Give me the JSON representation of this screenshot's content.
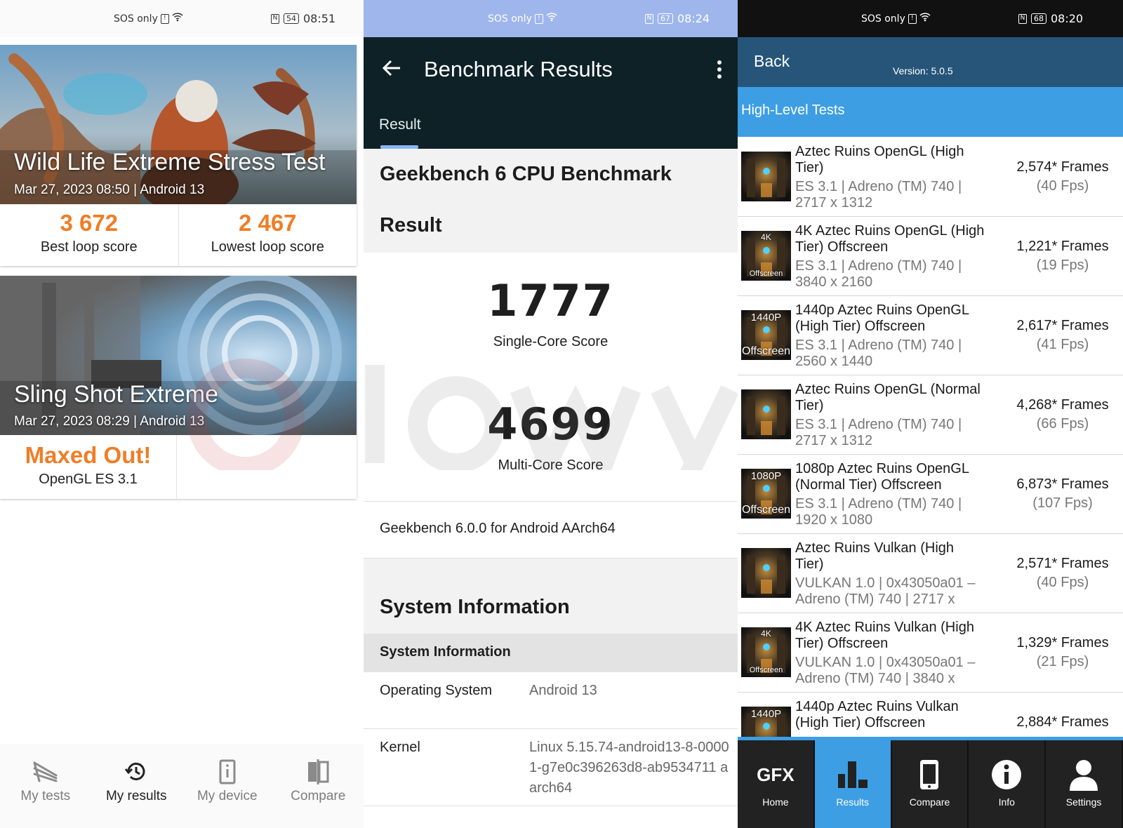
{
  "panel1": {
    "status": {
      "left": "SOS only",
      "battery": "54",
      "time": "08:51"
    },
    "cards": [
      {
        "title": "Wild Life Extreme Stress Test",
        "subtitle": "Mar 27, 2023 08:50 | Android 13",
        "score1_value": "3 672",
        "score1_label": "Best loop score",
        "score2_value": "2 467",
        "score2_label": "Lowest loop score"
      },
      {
        "title": "Sling Shot Extreme",
        "subtitle": "Mar 27, 2023 08:29 | Android 13",
        "score1_value": "Maxed Out!",
        "score1_label": "OpenGL ES 3.1"
      }
    ],
    "nav": [
      {
        "label": "My tests",
        "icon": "3dmark-logo-icon"
      },
      {
        "label": "My results",
        "icon": "history-icon"
      },
      {
        "label": "My device",
        "icon": "device-info-icon"
      },
      {
        "label": "Compare",
        "icon": "compare-icon"
      }
    ],
    "accent": "#f07d25"
  },
  "panel2": {
    "status": {
      "left": "SOS only",
      "battery": "67",
      "time": "08:24"
    },
    "header_title": "Benchmark Results",
    "tab_label": "Result",
    "benchmark_title": "Geekbench 6 CPU Benchmark",
    "result_heading": "Result",
    "single_core": {
      "value": "1777",
      "label": "Single-Core Score"
    },
    "multi_core": {
      "value": "4699",
      "label": "Multi-Core Score"
    },
    "version_text": "Geekbench 6.0.0 for Android AArch64",
    "sysinfo_heading": "System Information",
    "sysinfo_subheading": "System Information",
    "sysinfo_rows": [
      {
        "key": "Operating System",
        "value": "Android 13"
      },
      {
        "key": "Kernel",
        "value": "Linux 5.15.74-android13-8-00001-g7e0c396263d8-ab9534711 aarch64"
      }
    ],
    "colors": {
      "header": "#0d2127",
      "status": "#9fb6ec",
      "tab_indicator": "#8cb3f3"
    }
  },
  "panel3": {
    "status": {
      "left": "SOS only",
      "battery": "68",
      "time": "08:20"
    },
    "back_label": "Back",
    "version": "Version: 5.0.5",
    "section_title": "High-Level Tests",
    "tests": [
      {
        "name": "Aztec Ruins OpenGL (High Tier)",
        "desc": "ES 3.1 | Adreno (TM) 740 | 2717 x 1312",
        "frames": "2,574* Frames",
        "fps": "(40 Fps)",
        "badge": ""
      },
      {
        "name": "4K Aztec Ruins OpenGL (High Tier) Offscreen",
        "desc": "ES 3.1 | Adreno (TM) 740 | 3840 x 2160",
        "frames": "1,221* Frames",
        "fps": "(19 Fps)",
        "badge": "4K"
      },
      {
        "name": "1440p Aztec Ruins OpenGL (High Tier) Offscreen",
        "desc": "ES 3.1 | Adreno (TM) 740 | 2560 x 1440",
        "frames": "2,617* Frames",
        "fps": "(41 Fps)",
        "badge": "1440P"
      },
      {
        "name": "Aztec Ruins OpenGL (Normal Tier)",
        "desc": "ES 3.1 | Adreno (TM) 740 | 2717 x 1312",
        "frames": "4,268* Frames",
        "fps": "(66 Fps)",
        "badge": ""
      },
      {
        "name": "1080p Aztec Ruins OpenGL (Normal Tier) Offscreen",
        "desc": "ES 3.1 | Adreno (TM) 740 | 1920 x 1080",
        "frames": "6,873* Frames",
        "fps": "(107 Fps)",
        "badge": "1080P"
      },
      {
        "name": "Aztec Ruins Vulkan (High Tier)",
        "desc": "VULKAN 1.0 | 0x43050a01 – Adreno (TM) 740 | 2717 x",
        "frames": "2,571* Frames",
        "fps": "(40 Fps)",
        "badge": ""
      },
      {
        "name": "4K Aztec Ruins Vulkan (High Tier) Offscreen",
        "desc": "VULKAN 1.0 | 0x43050a01 – Adreno (TM) 740 | 3840 x",
        "frames": "1,329* Frames",
        "fps": "(21 Fps)",
        "badge": "4K"
      },
      {
        "name": "1440p Aztec Ruins Vulkan (High Tier) Offscreen",
        "desc": "",
        "frames": "2,884* Frames",
        "fps": "",
        "badge": "1440P"
      }
    ],
    "offscreen_label": "Offscreen",
    "offscreen_small_label": "Offscreen",
    "nav": [
      {
        "label": "Home",
        "icon": "gfx-logo-icon",
        "logo_text": "GFX"
      },
      {
        "label": "Results",
        "icon": "bar-chart-icon"
      },
      {
        "label": "Compare",
        "icon": "phone-icon"
      },
      {
        "label": "Info",
        "icon": "info-icon"
      },
      {
        "label": "Settings",
        "icon": "user-icon"
      }
    ],
    "colors": {
      "top_bar": "#265579",
      "section": "#3d9ee4",
      "nav_bg": "#222222"
    }
  }
}
